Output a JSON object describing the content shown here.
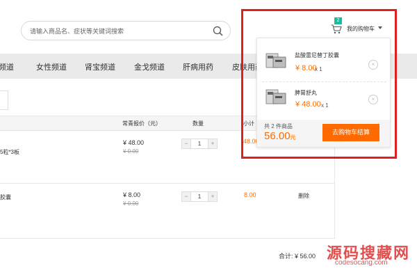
{
  "search": {
    "placeholder": "请输入商品名、症状等关键词搜索",
    "icon": "search-icon"
  },
  "cart": {
    "count": "2",
    "label": "我的购物车"
  },
  "nav": {
    "items": [
      "频道",
      "女性频道",
      "肾宝频道",
      "金戈频道",
      "肝病用药",
      "皮肤用药"
    ]
  },
  "table": {
    "headers": {
      "price": "常青报价（元）",
      "qty": "数量",
      "subtotal": "小计"
    },
    "rows": [
      {
        "name": "5粒*3板",
        "price": "¥ 48.00",
        "orig": "¥ 0.00",
        "qty": "1",
        "subtotal": "48.00",
        "action": ""
      },
      {
        "name": "胶囊",
        "price": "¥ 8.00",
        "orig": "¥ 0.00",
        "qty": "1",
        "subtotal": "8.00",
        "action": "删除"
      }
    ],
    "total": "合计: ¥ 56.00"
  },
  "mini_cart": {
    "items": [
      {
        "name": "盐酸雷尼替丁胶囊",
        "price": "¥ 8.00",
        "qty": "x 1",
        "remove": "×"
      },
      {
        "name": "脾胃舒丸",
        "price": "¥ 48.00",
        "qty": "x 1",
        "remove": "×"
      }
    ],
    "count_text": "共 2 件商品",
    "total": "56.00",
    "unit": "元",
    "checkout": "去购物车结算"
  },
  "watermark": {
    "big": "源码搜藏网",
    "small": "codesocang.com"
  },
  "colors": {
    "accent": "#ff6a00",
    "badge": "#1abc9c",
    "highlight": "#e01e1e"
  }
}
